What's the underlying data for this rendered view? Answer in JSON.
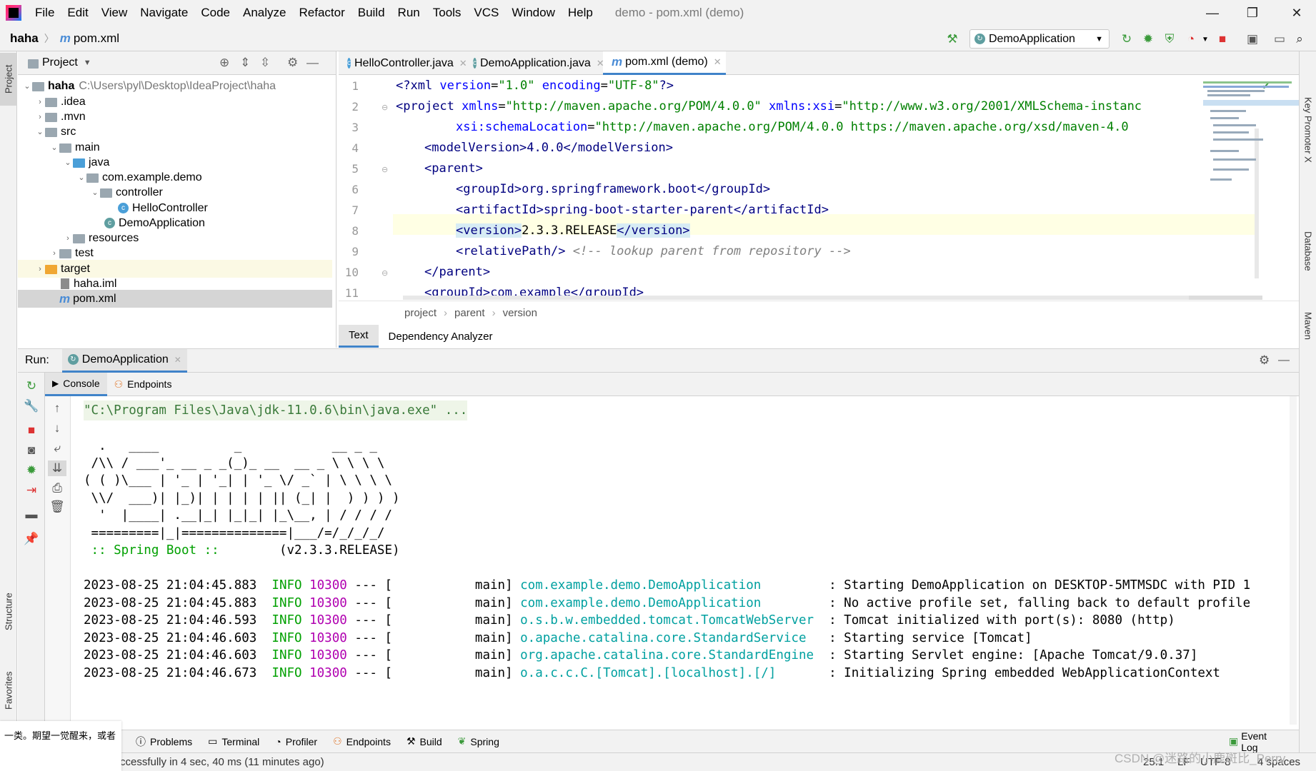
{
  "menubar": {
    "items": [
      "File",
      "Edit",
      "View",
      "Navigate",
      "Code",
      "Analyze",
      "Refactor",
      "Build",
      "Run",
      "Tools",
      "VCS",
      "Window",
      "Help"
    ],
    "title": "demo - pom.xml (demo)"
  },
  "navbar": {
    "project": "haha",
    "file": "pom.xml",
    "run_config": "DemoApplication"
  },
  "left_stripe": {
    "project_tab": "Project",
    "structure_tab": "Structure",
    "favorites_tab": "Favorites"
  },
  "right_stripe": {
    "key_promoter": "Key Promoter X",
    "database": "Database",
    "maven": "Maven"
  },
  "project_panel": {
    "title": "Project",
    "tree": [
      {
        "label": "haha",
        "path": "C:\\Users\\pyl\\Desktop\\IdeaProject\\haha",
        "kind": "root"
      },
      {
        "label": ".idea",
        "kind": "folder"
      },
      {
        "label": ".mvn",
        "kind": "folder"
      },
      {
        "label": "src",
        "kind": "folder"
      },
      {
        "label": "main",
        "kind": "folder"
      },
      {
        "label": "java",
        "kind": "folder-blue"
      },
      {
        "label": "com.example.demo",
        "kind": "package"
      },
      {
        "label": "controller",
        "kind": "package"
      },
      {
        "label": "HelloController",
        "kind": "class"
      },
      {
        "label": "DemoApplication",
        "kind": "spring-class"
      },
      {
        "label": "resources",
        "kind": "folder"
      },
      {
        "label": "test",
        "kind": "folder"
      },
      {
        "label": "target",
        "kind": "folder-orange"
      },
      {
        "label": "haha.iml",
        "kind": "file"
      },
      {
        "label": "pom.xml",
        "kind": "maven"
      }
    ]
  },
  "editor": {
    "tabs": [
      "HelloController.java",
      "DemoApplication.java",
      "pom.xml (demo)"
    ],
    "lines": [
      {
        "n": "1"
      },
      {
        "n": "2"
      },
      {
        "n": "3"
      },
      {
        "n": "4"
      },
      {
        "n": "5"
      },
      {
        "n": "6"
      },
      {
        "n": "7"
      },
      {
        "n": "8"
      },
      {
        "n": "9"
      },
      {
        "n": "10"
      },
      {
        "n": "11"
      }
    ],
    "code": {
      "l1a": "<?xml ",
      "l1b": "version",
      "l1c": "=",
      "l1d": "\"1.0\"",
      "l1e": " encoding",
      "l1f": "=",
      "l1g": "\"UTF-8\"",
      "l1h": "?>",
      "l2a": "<project ",
      "l2b": "xmlns",
      "l2c": "=",
      "l2d": "\"http://maven.apache.org/POM/4.0.0\"",
      "l2e": " xmlns:xsi",
      "l2f": "=",
      "l2g": "\"http://www.w3.org/2001/XMLSchema-instanc",
      "l3a": "xsi:schemaLocation",
      "l3b": "=",
      "l3c": "\"http://maven.apache.org/POM/4.0.0 https://maven.apache.org/xsd/maven-4.0",
      "l4": "<modelVersion>4.0.0</modelVersion>",
      "l5": "<parent>",
      "l6": "<groupId>org.springframework.boot</groupId>",
      "l7": "<artifactId>spring-boot-starter-parent</artifactId>",
      "l8a": "<version>",
      "l8b": "2.3.3.RELEASE",
      "l8c": "</version>",
      "l9a": "<relativePath/>",
      "l9b": " <!-- lookup parent from repository -->",
      "l10": "</parent>",
      "l11": "<groupId>com.example</groupId>"
    },
    "breadcrumb": [
      "project",
      "parent",
      "version"
    ],
    "bottom_tabs": [
      "Text",
      "Dependency Analyzer"
    ]
  },
  "run": {
    "label": "Run:",
    "config_tab": "DemoApplication",
    "sub_tabs": [
      "Console",
      "Endpoints"
    ],
    "console": {
      "cmd": "\"C:\\Program Files\\Java\\jdk-11.0.6\\bin\\java.exe\" ...",
      "banner": [
        "  .   ____          _            __ _ _",
        " /\\\\ / ___'_ __ _ _(_)_ __  __ _ \\ \\ \\ \\",
        "( ( )\\___ | '_ | '_| | '_ \\/ _` | \\ \\ \\ \\",
        " \\\\/  ___)| |_)| | | | | || (_| |  ) ) ) )",
        "  '  |____| .__|_| |_|_| |_\\__, | / / / /",
        " =========|_|==============|___/=/_/_/_/"
      ],
      "spring_boot": " :: Spring Boot :: ",
      "version": "       (v2.3.3.RELEASE)",
      "logs": [
        {
          "ts": "2023-08-25 21:04:45.883",
          "level": "INFO",
          "pid": "10300",
          "sep": " --- [           main] ",
          "logger": "com.example.demo.DemoApplication        ",
          "msg": " : Starting DemoApplication on DESKTOP-5MTMSDC with PID 1"
        },
        {
          "ts": "2023-08-25 21:04:45.883",
          "level": "INFO",
          "pid": "10300",
          "sep": " --- [           main] ",
          "logger": "com.example.demo.DemoApplication        ",
          "msg": " : No active profile set, falling back to default profile"
        },
        {
          "ts": "2023-08-25 21:04:46.593",
          "level": "INFO",
          "pid": "10300",
          "sep": " --- [           main] ",
          "logger": "o.s.b.w.embedded.tomcat.TomcatWebServer ",
          "msg": " : Tomcat initialized with port(s): 8080 (http)"
        },
        {
          "ts": "2023-08-25 21:04:46.603",
          "level": "INFO",
          "pid": "10300",
          "sep": " --- [           main] ",
          "logger": "o.apache.catalina.core.StandardService  ",
          "msg": " : Starting service [Tomcat]"
        },
        {
          "ts": "2023-08-25 21:04:46.603",
          "level": "INFO",
          "pid": "10300",
          "sep": " --- [           main] ",
          "logger": "org.apache.catalina.core.StandardEngine ",
          "msg": " : Starting Servlet engine: [Apache Tomcat/9.0.37]"
        },
        {
          "ts": "2023-08-25 21:04:46.673",
          "level": "INFO",
          "pid": "10300",
          "sep": " --- [           main] ",
          "logger": "o.a.c.c.C.[Tomcat].[localhost].[/]      ",
          "msg": " : Initializing Spring embedded WebApplicationContext"
        }
      ]
    }
  },
  "bottom_toolbar": [
    "Problems",
    "Terminal",
    "Profiler",
    "Endpoints",
    "Build",
    "Spring",
    "Event Log"
  ],
  "statusbar": {
    "message": "ccessfully in 4 sec, 40 ms (11 minutes ago)",
    "position": "25:1",
    "line_sep": "LF",
    "encoding": "UTF-8",
    "indent": "4 spaces"
  },
  "overlay_text": "一类。期望一觉醒来，或者",
  "watermark": "CSDN @迷路的小鹿斑比_Perry"
}
